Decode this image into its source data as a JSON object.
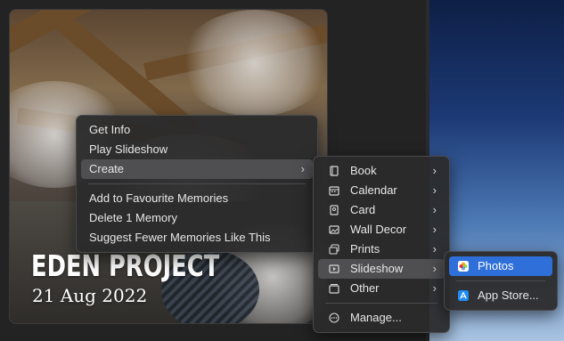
{
  "memory": {
    "title": "EDEN PROJECT",
    "date": "21 Aug 2022"
  },
  "context_menu": {
    "items": [
      {
        "label": "Get Info"
      },
      {
        "label": "Play Slideshow"
      },
      {
        "label": "Create",
        "submenu": true
      },
      {
        "label": "Add to Favourite Memories"
      },
      {
        "label": "Delete 1 Memory"
      },
      {
        "label": "Suggest Fewer Memories Like This"
      }
    ]
  },
  "create_menu": {
    "items": [
      {
        "label": "Book",
        "icon": "book-icon"
      },
      {
        "label": "Calendar",
        "icon": "calendar-icon"
      },
      {
        "label": "Card",
        "icon": "card-icon"
      },
      {
        "label": "Wall Decor",
        "icon": "wall-decor-icon"
      },
      {
        "label": "Prints",
        "icon": "prints-icon"
      },
      {
        "label": "Slideshow",
        "icon": "slideshow-icon"
      },
      {
        "label": "Other",
        "icon": "other-icon"
      },
      {
        "label": "Manage...",
        "icon": "manage-icon"
      }
    ]
  },
  "slideshow_menu": {
    "items": [
      {
        "label": "Photos",
        "icon": "photos-app-icon"
      },
      {
        "label": "App Store...",
        "icon": "app-store-icon"
      }
    ]
  },
  "colors": {
    "highlight": "#2e6fd9",
    "menu_background": "#2a2a2c"
  }
}
